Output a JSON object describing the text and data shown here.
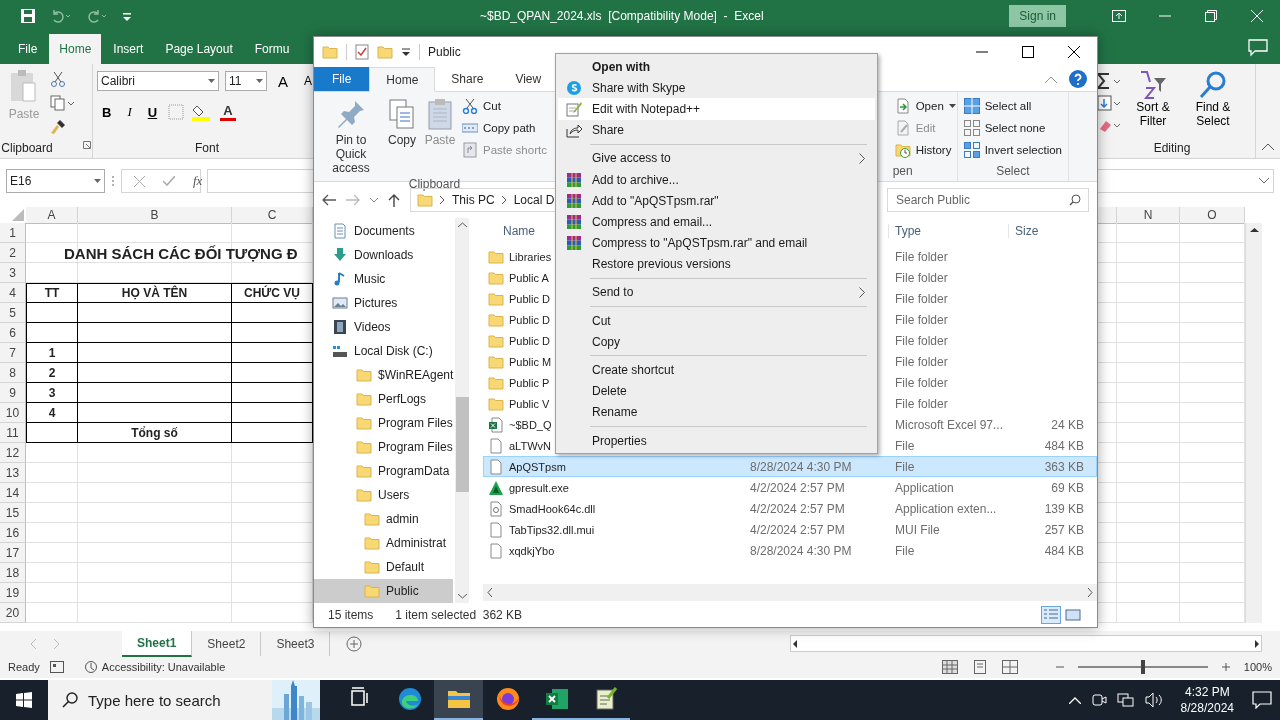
{
  "excel": {
    "title": "~$BD_QPAN_2024.xls  [Compatibility Mode]  -  Excel",
    "sign_in": "Sign in",
    "tabs": [
      {
        "label": "File",
        "selected": false
      },
      {
        "label": "Home",
        "selected": true
      },
      {
        "label": "Insert",
        "selected": false
      },
      {
        "label": "Page Layout",
        "selected": false
      },
      {
        "label": "Formu",
        "selected": false
      }
    ],
    "clipboard": {
      "paste": "Paste",
      "group": "Clipboard"
    },
    "font": {
      "name": "Calibri",
      "size": "11",
      "grow": "A",
      "shrink": "A",
      "bold": "B",
      "italic": "I",
      "underline": "U",
      "font_color_label": "A",
      "group": "Font"
    },
    "editing": {
      "sort": "Sort & Filter",
      "find": "Find & Select",
      "group": "Editing"
    },
    "name_box": "E16",
    "function_label": "fx",
    "columns": [
      {
        "label": "A"
      },
      {
        "label": "B"
      },
      {
        "label": "C"
      },
      {
        "label": "N"
      },
      {
        "label": "O"
      }
    ],
    "rows": [
      {
        "number": "1",
        "kind": "plain"
      },
      {
        "number": "2",
        "kind": "title",
        "title": "DANH SÁCH CÁC ĐỐI TƯỢNG Đ"
      },
      {
        "number": "3",
        "kind": "plain"
      },
      {
        "number": "4",
        "kind": "table",
        "A": "TT",
        "B": "HỌ VÀ TÊN",
        "C": "CHỨC VỤ"
      },
      {
        "number": "5",
        "kind": "table"
      },
      {
        "number": "6",
        "kind": "table"
      },
      {
        "number": "7",
        "kind": "table",
        "A": "1"
      },
      {
        "number": "8",
        "kind": "table",
        "A": "2"
      },
      {
        "number": "9",
        "kind": "table",
        "A": "3"
      },
      {
        "number": "10",
        "kind": "table",
        "A": "4"
      },
      {
        "number": "11",
        "kind": "table",
        "B": "Tổng số"
      },
      {
        "number": "12",
        "kind": "plain"
      },
      {
        "number": "13",
        "kind": "plain"
      },
      {
        "number": "14",
        "kind": "plain"
      },
      {
        "number": "15",
        "kind": "plain"
      },
      {
        "number": "16",
        "kind": "plain"
      },
      {
        "number": "17",
        "kind": "plain"
      },
      {
        "number": "18",
        "kind": "plain"
      },
      {
        "number": "19",
        "kind": "plain"
      },
      {
        "number": "20",
        "kind": "plain"
      }
    ],
    "sheets": [
      {
        "label": "Sheet1",
        "selected": true
      },
      {
        "label": "Sheet2",
        "selected": false
      },
      {
        "label": "Sheet3",
        "selected": false
      }
    ],
    "status": "Ready",
    "accessibility": "Accessibility: Unavailable",
    "zoom": {
      "level": 0.5,
      "reading": "100%"
    }
  },
  "explorer": {
    "title": "Public",
    "tabs": [
      {
        "label": "File",
        "kind": "file",
        "selected": false
      },
      {
        "label": "Home",
        "kind": "tab",
        "selected": true
      },
      {
        "label": "Share",
        "kind": "tab",
        "selected": false
      },
      {
        "label": "View",
        "kind": "tab",
        "selected": false
      }
    ],
    "clipboard": {
      "group": "Clipboard",
      "large": [
        {
          "label": "Pin to Quick access",
          "kind": "pin",
          "disabled": false
        },
        {
          "label": "Copy",
          "kind": "copy",
          "disabled": false
        },
        {
          "label": "Paste",
          "kind": "paste",
          "disabled": true
        }
      ],
      "small": [
        {
          "label": "Cut",
          "kind": "cut",
          "disabled": false
        },
        {
          "label": "Copy path",
          "kind": "copypath",
          "disabled": false
        },
        {
          "label": "Paste shortc",
          "kind": "shortcut",
          "disabled": true
        }
      ]
    },
    "open": {
      "group": "pen",
      "small": [
        {
          "label": "Open",
          "kind": "open",
          "disabled": false
        },
        {
          "label": "Edit",
          "kind": "edit",
          "disabled": true
        },
        {
          "label": "History",
          "kind": "history",
          "disabled": false
        }
      ]
    },
    "select": {
      "group": "Select",
      "small": [
        {
          "label": "Select all",
          "kind": "all",
          "disabled": false
        },
        {
          "label": "Select none",
          "kind": "none",
          "disabled": false
        },
        {
          "label": "Invert selection",
          "kind": "invert",
          "disabled": false
        }
      ]
    },
    "path": [
      "This PC",
      "Local D"
    ],
    "search_placeholder": "Search Public",
    "nav": [
      {
        "label": "Documents",
        "kind": "documents",
        "selected": false
      },
      {
        "label": "Downloads",
        "kind": "downloads",
        "selected": false
      },
      {
        "label": "Music",
        "kind": "music",
        "selected": false
      },
      {
        "label": "Pictures",
        "kind": "pictures",
        "selected": false
      },
      {
        "label": "Videos",
        "kind": "videos",
        "selected": false
      },
      {
        "label": "Local Disk (C:)",
        "kind": "disk",
        "selected": false,
        "children": [
          {
            "label": "$WinREAgent",
            "kind": "folder",
            "selected": false
          },
          {
            "label": "PerfLogs",
            "kind": "folder",
            "selected": false
          },
          {
            "label": "Program Files",
            "kind": "folder",
            "selected": false
          },
          {
            "label": "Program Files",
            "kind": "folder",
            "selected": false
          },
          {
            "label": "ProgramData",
            "kind": "folder",
            "selected": false
          },
          {
            "label": "Users",
            "kind": "folder",
            "selected": false,
            "children": [
              {
                "label": "admin",
                "kind": "folder",
                "selected": false
              },
              {
                "label": "Administrat",
                "kind": "folder",
                "selected": false
              },
              {
                "label": "Default",
                "kind": "folder",
                "selected": false
              },
              {
                "label": "Public",
                "kind": "folder",
                "selected": true
              }
            ]
          }
        ]
      }
    ],
    "columns": [
      "Name",
      "Type",
      "Size"
    ],
    "files": [
      {
        "name": "Libraries",
        "kind": "folder",
        "type": "File folder",
        "selected": false
      },
      {
        "name": "Public A",
        "kind": "folder",
        "type": "File folder",
        "selected": false
      },
      {
        "name": "Public D",
        "kind": "folder",
        "type": "File folder",
        "selected": false
      },
      {
        "name": "Public D",
        "kind": "folder",
        "type": "File folder",
        "selected": false
      },
      {
        "name": "Public D",
        "kind": "folder",
        "type": "File folder",
        "selected": false
      },
      {
        "name": "Public M",
        "kind": "folder",
        "type": "File folder",
        "selected": false
      },
      {
        "name": "Public P",
        "kind": "folder",
        "type": "File folder",
        "selected": false
      },
      {
        "name": "Public V",
        "kind": "folder",
        "type": "File folder",
        "selected": false
      },
      {
        "name": "~$BD_Q",
        "kind": "excel",
        "type": "Microsoft Excel 97...",
        "size": "24 KB",
        "selected": false
      },
      {
        "name": "aLTWvN",
        "kind": "file",
        "type": "File",
        "size": "484 KB",
        "selected": false
      },
      {
        "name": "ApQSTpsm",
        "kind": "file",
        "modified": "8/28/2024 4:30 PM",
        "type": "File",
        "size": "363 KB",
        "selected": true
      },
      {
        "name": "gpresult.exe",
        "kind": "app",
        "modified": "4/2/2024 2:57 PM",
        "type": "Application",
        "size": "69 KB",
        "selected": false
      },
      {
        "name": "SmadHook64c.dll",
        "kind": "dll",
        "modified": "4/2/2024 2:57 PM",
        "type": "Application exten...",
        "size": "139 KB",
        "selected": false
      },
      {
        "name": "TabTips32.dll.mui",
        "kind": "file",
        "modified": "4/2/2024 2:57 PM",
        "type": "MUI File",
        "size": "257 KB",
        "selected": false
      },
      {
        "name": "xqdkjYbo",
        "kind": "file",
        "modified": "8/28/2024 4:30 PM",
        "type": "File",
        "size": "484 KB",
        "selected": false
      }
    ],
    "status": {
      "count": "15 items",
      "selection": "1 item selected  362 KB"
    },
    "views": [
      {
        "kind": "details",
        "selected": true
      },
      {
        "kind": "icons",
        "selected": false
      }
    ]
  },
  "context_menu": {
    "items": [
      {
        "label": "Open with",
        "kind": "header",
        "submenu": false,
        "highlighted": false
      },
      {
        "label": "Share with Skype",
        "kind": "skype",
        "submenu": false,
        "highlighted": false
      },
      {
        "label": "Edit with Notepad++",
        "kind": "notepad",
        "submenu": false,
        "highlighted": true
      },
      {
        "label": "Share",
        "kind": "share",
        "submenu": false,
        "highlighted": false
      },
      {
        "kind": "separator"
      },
      {
        "label": "Give access to",
        "kind": "plain",
        "submenu": true,
        "highlighted": false
      },
      {
        "label": "Add to archive...",
        "kind": "archive",
        "submenu": false,
        "highlighted": false
      },
      {
        "label": "Add to \"ApQSTpsm.rar\"",
        "kind": "archive",
        "submenu": false,
        "highlighted": false
      },
      {
        "label": "Compress and email...",
        "kind": "archive",
        "submenu": false,
        "highlighted": false
      },
      {
        "label": "Compress to \"ApQSTpsm.rar\" and email",
        "kind": "archive",
        "submenu": false,
        "highlighted": false
      },
      {
        "label": "Restore previous versions",
        "kind": "plain",
        "submenu": false,
        "highlighted": false
      },
      {
        "kind": "separator"
      },
      {
        "label": "Send to",
        "kind": "plain",
        "submenu": true,
        "highlighted": false
      },
      {
        "kind": "separator"
      },
      {
        "label": "Cut",
        "kind": "plain",
        "submenu": false,
        "highlighted": false
      },
      {
        "label": "Copy",
        "kind": "plain",
        "submenu": false,
        "highlighted": false
      },
      {
        "kind": "separator"
      },
      {
        "label": "Create shortcut",
        "kind": "plain",
        "submenu": false,
        "highlighted": false
      },
      {
        "label": "Delete",
        "kind": "plain",
        "submenu": false,
        "highlighted": false
      },
      {
        "label": "Rename",
        "kind": "plain",
        "submenu": false,
        "highlighted": false
      },
      {
        "kind": "separator"
      },
      {
        "label": "Properties",
        "kind": "plain",
        "submenu": false,
        "highlighted": false
      }
    ]
  },
  "taskbar": {
    "search_placeholder": "Type here to search",
    "apps": [
      {
        "kind": "taskview",
        "running": false,
        "selected": false
      },
      {
        "kind": "edge",
        "running": false,
        "selected": false
      },
      {
        "kind": "explorer",
        "running": true,
        "selected": true
      },
      {
        "kind": "firefox",
        "running": false,
        "selected": false
      },
      {
        "kind": "excel",
        "running": true,
        "selected": false
      },
      {
        "kind": "notepad",
        "running": true,
        "selected": false
      }
    ],
    "time": "4:32 PM",
    "date": "8/28/2024"
  }
}
